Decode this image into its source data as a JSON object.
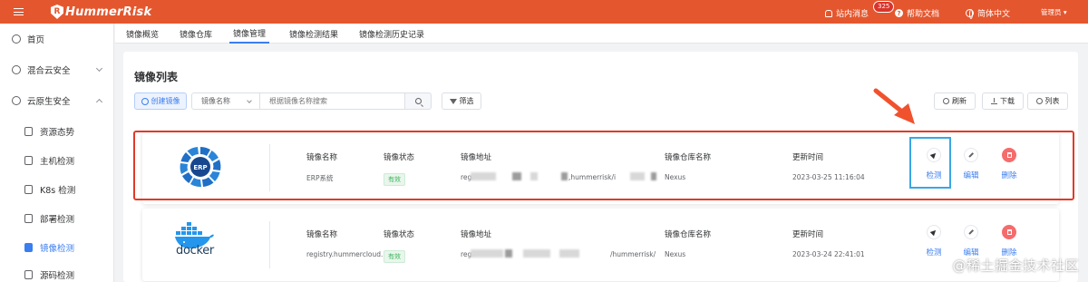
{
  "header": {
    "app_name": "HummerRisk",
    "logo_letter": "R",
    "messages_label": "站内消息",
    "messages_count": "325",
    "help_label": "帮助文档",
    "lang_label": "简体中文",
    "user_label": "管理员 ▾"
  },
  "sidebar": {
    "items": [
      {
        "label": "首页"
      },
      {
        "label": "混合云安全"
      },
      {
        "label": "云原生安全"
      }
    ],
    "sub_items": [
      {
        "label": "资源态势"
      },
      {
        "label": "主机检测"
      },
      {
        "label": "K8s 检测"
      },
      {
        "label": "部署检测"
      },
      {
        "label": "镜像检测"
      },
      {
        "label": "源码检测"
      }
    ]
  },
  "tabs": [
    {
      "label": "镜像概览"
    },
    {
      "label": "镜像仓库"
    },
    {
      "label": "镜像管理"
    },
    {
      "label": "镜像检测结果"
    },
    {
      "label": "镜像检测历史记录"
    }
  ],
  "main": {
    "title": "镜像列表",
    "create_label": "创建镜像",
    "search_select": "镜像名称",
    "search_placeholder": "根据镜像名称搜索",
    "filter_label": "筛选",
    "refresh_label": "刷新",
    "download_label": "下载",
    "list_label": "列表"
  },
  "columns": {
    "name": "镜像名称",
    "status": "镜像状态",
    "address": "镜像地址",
    "repo": "镜像仓库名称",
    "updated": "更新时间"
  },
  "actions": {
    "detect": "检测",
    "edit": "编辑",
    "delete": "删除"
  },
  "rows": [
    {
      "logo_text": "ERP",
      "name": "ERP系统",
      "status": "有效",
      "address_prefix": "regi",
      "address_mid": ",hummerrisk/i",
      "repo": "Nexus",
      "updated": "2023-03-25 11:16:04"
    },
    {
      "logo_text": "docker",
      "name": "registry.hummercloud...",
      "status": "有效",
      "address_prefix": "regi",
      "address_mid": "/hummerrisk/",
      "repo": "Nexus",
      "updated": "2023-03-24 22:41:01"
    }
  ],
  "watermark": "@稀土掘金技术社区",
  "colors": {
    "brand": "#e4572e",
    "accent": "#3a7ef0",
    "highlight_frame": "#e03a28",
    "detect_frame": "#3aa6e4",
    "status_tag": "#42b35c",
    "delete": "#f56c6c"
  },
  "icons": {
    "menu": "hamburger-menu-icon",
    "bell": "bell-icon",
    "help": "help-icon",
    "globe": "globe-icon",
    "search": "search-icon",
    "filter": "funnel-icon",
    "detect": "send-icon",
    "edit": "pen-icon",
    "delete": "trash-icon"
  }
}
